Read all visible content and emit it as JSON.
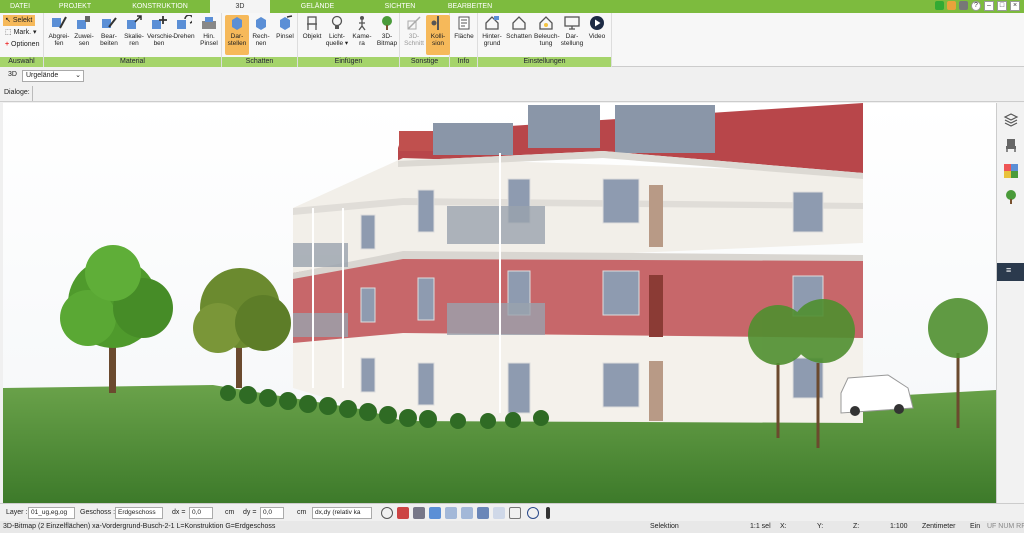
{
  "tabs": [
    {
      "label": "DATEI",
      "active": false
    },
    {
      "label": "PROJEKT",
      "active": false
    },
    {
      "label": "KONSTRUKTION",
      "active": false
    },
    {
      "label": "3D",
      "active": true
    },
    {
      "label": "GELÄNDE",
      "active": false
    },
    {
      "label": "SICHTEN",
      "active": false
    },
    {
      "label": "BEARBEITEN",
      "active": false
    }
  ],
  "window_controls": {
    "min": "–",
    "max": "□",
    "close": "×",
    "help": "?"
  },
  "ribbon": {
    "auswahl": {
      "caption": "Auswahl",
      "selekt": "Selekt",
      "mark": "Mark.",
      "optionen": "Optionen"
    },
    "material": {
      "caption": "Material",
      "buttons": [
        "Abgrei-\nfen",
        "Zuwei-\nsen",
        "Bear-\nbeiten",
        "Skalie-\nren",
        "Verschie-\nben",
        "Drehen",
        "Hin.\nPinsel"
      ]
    },
    "schatten": {
      "caption": "Schatten",
      "buttons": [
        "Dar-\nstellen",
        "Rech-\nnen",
        "Pinsel"
      ]
    },
    "einfuegen": {
      "caption": "Einfügen",
      "buttons": [
        "Objekt",
        "Licht-\nquelle ▾",
        "Kame-\nra",
        "3D-\nBitmap"
      ]
    },
    "sonstige": {
      "caption": "Sonstige",
      "buttons": [
        "3D-\nSchnitt",
        "Kolli-\nsion"
      ]
    },
    "info": {
      "caption": "Info",
      "buttons": [
        "Fläche"
      ]
    },
    "einstellungen": {
      "caption": "Einstellungen",
      "buttons": [
        "Hinter-\ngrund",
        "Schatten",
        "Beleuch-\ntung",
        "Dar-\nstellung",
        "Video"
      ]
    }
  },
  "viewbar": {
    "mode": "3D",
    "terrain": "Urgelände"
  },
  "dialogbar": {
    "label": "Dialoge:"
  },
  "optbar": {
    "layer_label": "Layer :",
    "layer_value": "01_ug,eg,og",
    "geschoss_label": "Geschoss :",
    "geschoss_value": "Erdgeschoss",
    "dx_label": "dx =",
    "dx_value": "0,0",
    "dx_unit": "cm",
    "dy_label": "dy =",
    "dy_value": "0,0",
    "dy_unit": "cm",
    "mode_value": "dx,dy (relativ ka"
  },
  "statusbar": {
    "info": "3D-Bitmap (2 Einzelflächen) xa-Vordergrund-Busch-2-1 L=Konstruktion G=Erdgeschoss",
    "selektion": "Selektion",
    "sel_count": "1:1 sel",
    "x": "X:",
    "y": "Y:",
    "z": "Z:",
    "scale": "1:100",
    "unit": "Zentimeter",
    "ein": "Ein",
    "flags": "UF NUM RF"
  },
  "colors": {
    "brand_green": "#7dbb3e",
    "caption_green": "#a5d46a",
    "active_orange": "#f6b95a"
  }
}
